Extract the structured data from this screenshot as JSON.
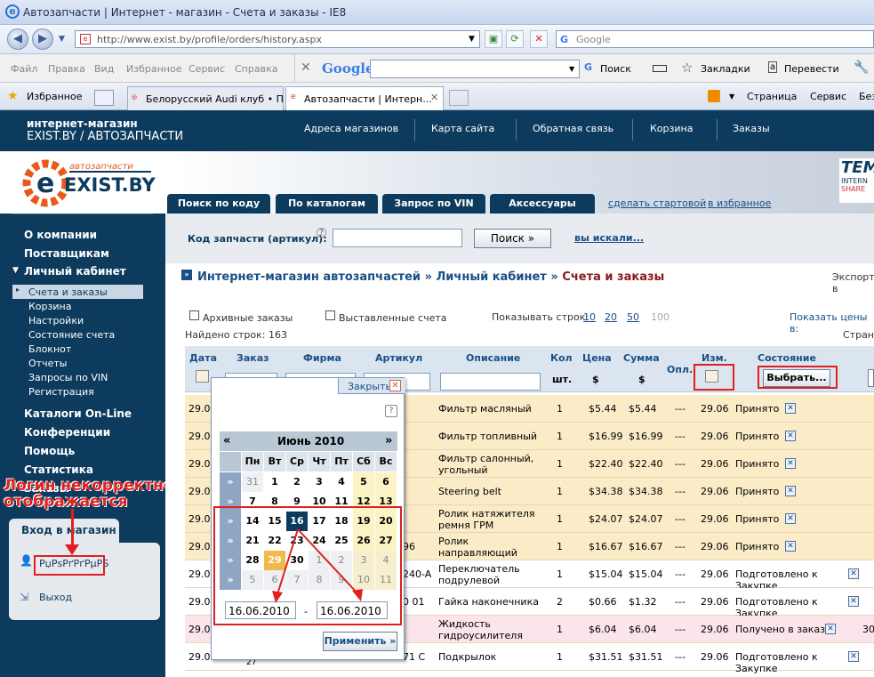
{
  "window": {
    "title": "Автозапчасти | Интернет - магазин - Счета и заказы - IE8",
    "url": "http://www.exist.by/profile/orders/history.aspx",
    "search_placeholder": "Google"
  },
  "menu": [
    "Файл",
    "Правка",
    "Вид",
    "Избранное",
    "Сервис",
    "Справка"
  ],
  "google_bar": {
    "logo": "Google",
    "search": "Поиск",
    "bookmarks": "Закладки",
    "translate": "Перевести"
  },
  "favorites": {
    "label": "Избранное",
    "tabs": [
      "Белорусский Audi клуб • Пр...",
      "Автозапчасти | Интерн..."
    ],
    "right": [
      "Страница",
      "Сервис",
      "Без"
    ]
  },
  "site": {
    "brand_line1": "интернет-магазин",
    "brand_line2": "EXIST.BY / АВТОЗАПЧАСТИ",
    "nav": [
      "Адреса магазинов",
      "Карта сайта",
      "Обратная связь",
      "Корзина",
      "Заказы"
    ],
    "logo_small": "автозапчасти",
    "logo_big": "EXIST.BY",
    "partner": "TEM",
    "partner_sub": "INTERN",
    "partner_sub2": "SHARE"
  },
  "cat_tabs": [
    "Поиск по коду",
    "По каталогам",
    "Запрос по VIN",
    "Аксессуары"
  ],
  "top_links": [
    "сделать стартовой",
    "в избранное"
  ],
  "search": {
    "label": "Код запчасти (артикул):",
    "help": "?",
    "button": "Поиск »",
    "link": "вы искали..."
  },
  "sidebar": {
    "items": [
      "О компании",
      "Поставщикам",
      "Личный кабинет"
    ],
    "sub": [
      "Счета и заказы",
      "Корзина",
      "Настройки",
      "Состояние счета",
      "Блокнот",
      "Отчеты",
      "Запросы по VIN",
      "Регистрация"
    ],
    "items2": [
      "Каталоги On-Line",
      "Конференции",
      "Помощь",
      "Статистика",
      "Заказы"
    ],
    "login_title": "Вход в магазин",
    "user": "РџРѕРґРґРµРЅ",
    "logout": "Выход"
  },
  "annotation": {
    "line1": "Логин некорректно",
    "line2": "отображается"
  },
  "crumb": {
    "a": "Интернет-магазин автозапчастей",
    "b": "Личный кабинет",
    "c": "Счета и заказы",
    "sep": "»",
    "export": "Экспорт в"
  },
  "filters": {
    "archive": "Архивные заказы",
    "issued": "Выставленные счета",
    "rows_label": "Показывать строк:",
    "rows": [
      "10",
      "20",
      "50",
      "100"
    ],
    "found": "Найдено строк: 163",
    "prices": "Показать цены в:",
    "pages": "Страни"
  },
  "table": {
    "headers": [
      "Дата",
      "Заказ",
      "Фирма",
      "Артикул",
      "Описание",
      "Кол",
      "Цена",
      "Сумма",
      "Опл.",
      "Изм.",
      "Состояние"
    ],
    "sub": [
      "шт.",
      "$",
      "$"
    ],
    "choose": "Выбрать...",
    "rows": [
      {
        "date": "29.06",
        "desc": "Фильтр масляный",
        "qty": "1",
        "price": "$5.44",
        "sum": "$5.44",
        "paid": "---",
        "chg": "29.06",
        "status": "Принято",
        "extra": ""
      },
      {
        "date": "29.06",
        "desc": "Фильтр топливный",
        "qty": "1",
        "price": "$16.99",
        "sum": "$16.99",
        "paid": "---",
        "chg": "29.06",
        "status": "Принято",
        "extra": ""
      },
      {
        "date": "29.06",
        "desc": "Фильтр салонный, угольный",
        "qty": "1",
        "price": "$22.40",
        "sum": "$22.40",
        "paid": "---",
        "chg": "29.06",
        "status": "Принято",
        "extra": ""
      },
      {
        "date": "29.06",
        "desc": "Steering belt",
        "qty": "1",
        "price": "$34.38",
        "sum": "$34.38",
        "paid": "---",
        "chg": "29.06",
        "status": "Принято",
        "extra": ""
      },
      {
        "date": "29.06",
        "desc": "Ролик натяжителя ремня ГРМ",
        "qty": "1",
        "price": "$24.07",
        "sum": "$24.07",
        "paid": "---",
        "chg": "29.06",
        "status": "Принято",
        "extra": ""
      },
      {
        "date": "29.06",
        "desc": "Ролик направляющий ремня ГРМ",
        "qty": "1",
        "price": "$16.67",
        "sum": "$16.67",
        "paid": "---",
        "chg": "29.06",
        "status": "Принято",
        "extra": "96"
      },
      {
        "date": "29.06",
        "desc": "Переключатель подрулевой",
        "qty": "1",
        "price": "$15.04",
        "sum": "$15.04",
        "paid": "---",
        "chg": "29.06",
        "status": "Подготовлено к Закупке",
        "extra": "240-A"
      },
      {
        "date": "29.06",
        "desc": "Гайка наконечника",
        "qty": "2",
        "price": "$0.66",
        "sum": "$1.32",
        "paid": "---",
        "chg": "29.06",
        "status": "Подготовлено к Закупке",
        "extra": "0 01"
      },
      {
        "date": "29.06",
        "desc": "Жидкость гидроусилителя руля",
        "qty": "1",
        "price": "$6.04",
        "sum": "$6.04",
        "paid": "---",
        "chg": "29.06",
        "status": "Получено в заказ",
        "extra": ""
      },
      {
        "date": "29.06",
        "desc": "Подкрылок",
        "qty": "1",
        "price": "$31.51",
        "sum": "$31.51",
        "paid": "---",
        "chg": "29.06",
        "status": "Подготовлено к Закупке",
        "extra": "71 C"
      }
    ],
    "last_row_extra": "30",
    "tail": "27"
  },
  "calendar": {
    "close": "Закрыть",
    "month": "Июнь 2010",
    "prev": "«",
    "next": "»",
    "dow": [
      "Пн",
      "Вт",
      "Ср",
      "Чт",
      "Пт",
      "Сб",
      "Вс"
    ],
    "weeks": [
      [
        "31",
        "1",
        "2",
        "3",
        "4",
        "5",
        "6"
      ],
      [
        "7",
        "8",
        "9",
        "10",
        "11",
        "12",
        "13"
      ],
      [
        "14",
        "15",
        "16",
        "17",
        "18",
        "19",
        "20"
      ],
      [
        "21",
        "22",
        "23",
        "24",
        "25",
        "26",
        "27"
      ],
      [
        "28",
        "29",
        "30",
        "1",
        "2",
        "3",
        "4"
      ],
      [
        "5",
        "6",
        "7",
        "8",
        "9",
        "10",
        "11"
      ]
    ],
    "from": "16.06.2010",
    "dash": "-",
    "to": "16.06.2010",
    "apply": "Применить »"
  }
}
